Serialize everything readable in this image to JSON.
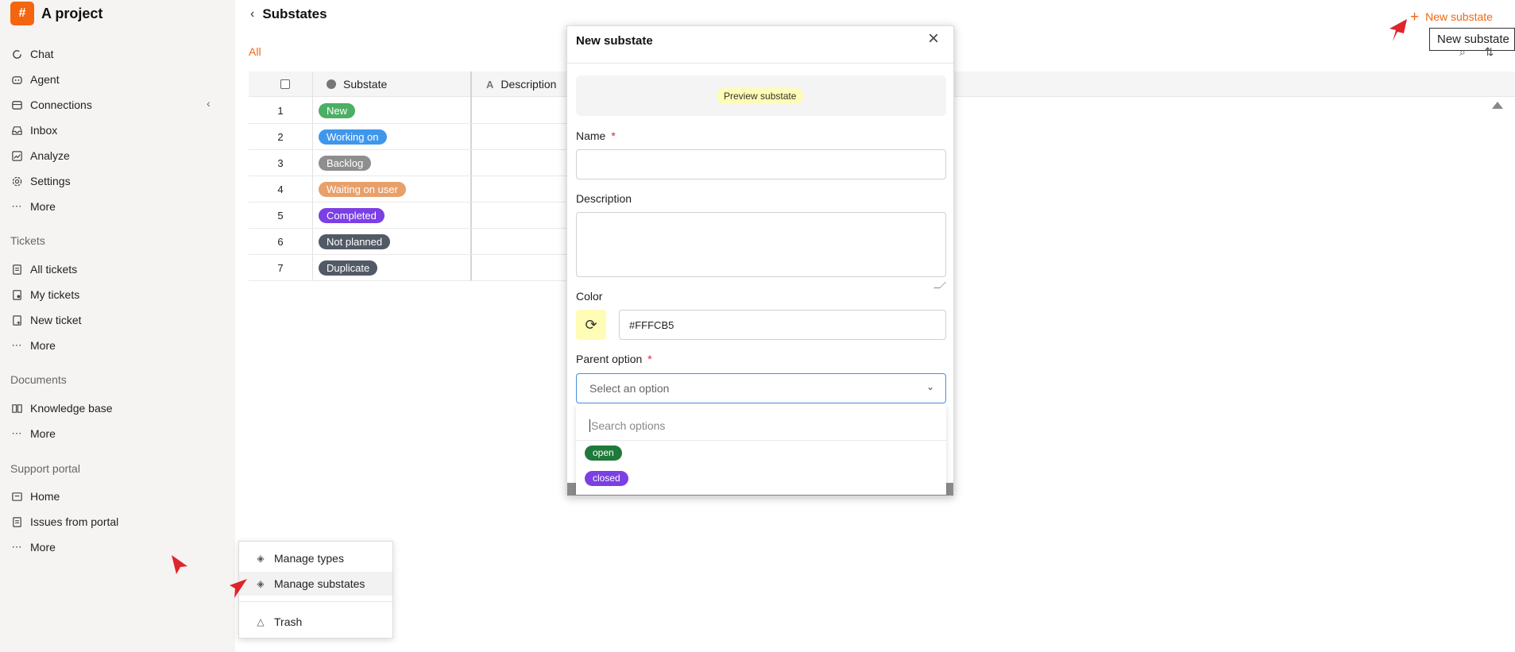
{
  "project": {
    "name": "A project",
    "logo_glyph": "#",
    "accent": "#f5650f"
  },
  "sidebar": {
    "main_items": [
      {
        "label": "Chat",
        "icon": "chat-icon"
      },
      {
        "label": "Agent",
        "icon": "agent-icon"
      },
      {
        "label": "Connections",
        "icon": "connections-icon"
      },
      {
        "label": "Inbox",
        "icon": "inbox-icon"
      },
      {
        "label": "Analyze",
        "icon": "analyze-icon"
      },
      {
        "label": "Settings",
        "icon": "gear-icon"
      },
      {
        "label": "More",
        "icon": "dots-icon"
      }
    ],
    "tickets_section": "Tickets",
    "tickets_items": [
      {
        "label": "All tickets",
        "icon": "tickets-icon"
      },
      {
        "label": "My tickets",
        "icon": "my-tickets-icon"
      },
      {
        "label": "New ticket",
        "icon": "new-ticket-icon"
      },
      {
        "label": "More",
        "icon": "dots-icon"
      }
    ],
    "documents_section": "Documents",
    "documents_items": [
      {
        "label": "Knowledge base",
        "icon": "book-icon"
      },
      {
        "label": "More",
        "icon": "dots-icon"
      }
    ],
    "portal_section": "Support portal",
    "portal_items": [
      {
        "label": "Home",
        "icon": "home-icon"
      },
      {
        "label": "Issues from portal",
        "icon": "issues-icon"
      },
      {
        "label": "More",
        "icon": "dots-icon"
      }
    ]
  },
  "header": {
    "title": "Substates",
    "tab_all": "All",
    "new_button": "New substate",
    "tooltip": "New substate"
  },
  "table": {
    "headers": {
      "substate": "Substate",
      "description": "Description"
    },
    "rows": [
      {
        "num": "1",
        "label": "New",
        "color": "#4caf64"
      },
      {
        "num": "2",
        "label": "Working on",
        "color": "#3f97ec"
      },
      {
        "num": "3",
        "label": "Backlog",
        "color": "#8e8e8e"
      },
      {
        "num": "4",
        "label": "Waiting on user",
        "color": "#e8a06a"
      },
      {
        "num": "5",
        "label": "Completed",
        "color": "#7b3fe4"
      },
      {
        "num": "6",
        "label": "Not planned",
        "color": "#525a66"
      },
      {
        "num": "7",
        "label": "Duplicate",
        "color": "#525a66"
      }
    ]
  },
  "modal": {
    "title": "New substate",
    "preview_label": "Preview substate",
    "name_label": "Name",
    "name_value": "",
    "description_label": "Description",
    "description_value": "",
    "color_label": "Color",
    "color_value": "#FFFCB5",
    "parent_label": "Parent option",
    "parent_placeholder": "Select an option",
    "required_mark": "*",
    "search_placeholder": "Search options",
    "options": [
      {
        "label": "open",
        "color": "#1e7a3a"
      },
      {
        "label": "closed",
        "color": "#7b3fe4"
      }
    ]
  },
  "context_menu": {
    "items": [
      {
        "label": "Manage types",
        "icon": "types-icon"
      },
      {
        "label": "Manage substates",
        "icon": "substates-icon"
      },
      {
        "label": "Trash",
        "icon": "trash-icon"
      }
    ]
  }
}
